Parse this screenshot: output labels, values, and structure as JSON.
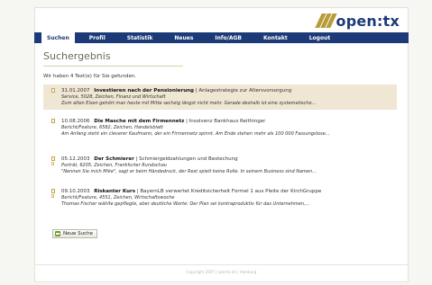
{
  "brand": {
    "logo_text": "open:tx"
  },
  "nav": {
    "tabs": [
      {
        "label": "Suchen",
        "active": true
      },
      {
        "label": "Profil",
        "active": false
      },
      {
        "label": "Statistik",
        "active": false
      },
      {
        "label": "Neues",
        "active": false
      },
      {
        "label": "Info/AGB",
        "active": false
      },
      {
        "label": "Kontakt",
        "active": false
      },
      {
        "label": "Logout",
        "active": false
      }
    ]
  },
  "main": {
    "title": "Suchergebnis",
    "result_count": "Wir haben 4 Text(e) für Sie gefunden.",
    "results": [
      {
        "date": "31.01.2007",
        "title": "Investieren nach der Pensionierung",
        "subtitle": "| Anlagestrategie zur Altersvorsorgung",
        "meta": "Service, 5028, Zeichen, Finanz und Wirtschaft",
        "excerpt": "Zum alten Eisen gehört man heute mit Mitte sechzig längst nicht mehr. Gerade deshalb ist eine systematische..."
      },
      {
        "date": "10.08.2006",
        "title": "Die Masche mit dem Firmennetz",
        "subtitle": "| Insolvenz Bankhaus Reithinger",
        "meta": "Bericht/Feature, 6582, Zeichen, Handelsblatt",
        "excerpt": "Am Anfang steht ein cleverer Kaufmann, der ein Firmennetz spinnt. Am Ende stehen mehr als 100 000 Fassungslose..."
      },
      {
        "date": "05.12.2003",
        "title": "Der Schmierer",
        "subtitle": "| Schmiergeldzahlungen und Bestechung",
        "meta": "Porträt, 6205, Zeichen, Frankfurter Rundschau",
        "excerpt": "\"Nennen Sie mich Mike\", sagt er beim Händedruck, der Rest spielt keine Rolle. In seinem Business sind Namen..."
      },
      {
        "date": "09.10.2003",
        "title": "Riskanter Kurs",
        "subtitle": "| BayernLB verwertet Kreditsicherheit Formel 1 aus Pleite der KirchGruppe",
        "meta": "Bericht/Feature, 4551, Zeichen, Wirtschaftswoche",
        "excerpt": "Thomas Fischer wählte gepflegte, aber deutliche Worte: Der Plan sei kontraproduktiv für das Unternehmen,..."
      }
    ],
    "new_search_label": "Neue Suche"
  },
  "footer": {
    "text": "Copyright 2007 | opentx.de | Hamburg"
  }
}
